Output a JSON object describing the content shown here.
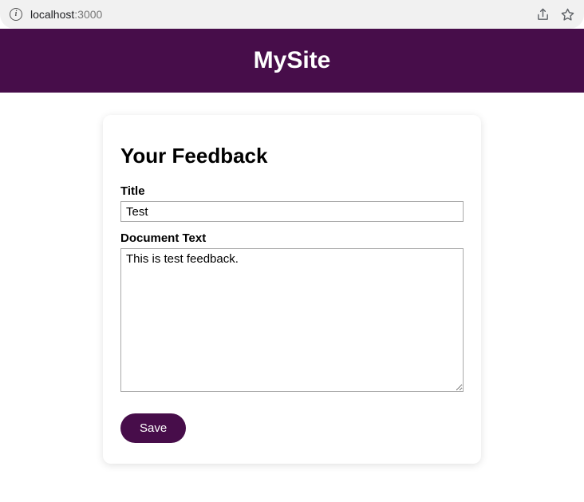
{
  "browser": {
    "url_host": "localhost",
    "url_port": ":3000"
  },
  "header": {
    "title": "MySite"
  },
  "form": {
    "heading": "Your Feedback",
    "title_label": "Title",
    "title_value": "Test",
    "body_label": "Document Text",
    "body_value": "This is test feedback.",
    "save_label": "Save"
  },
  "colors": {
    "brand": "#470d4a"
  }
}
